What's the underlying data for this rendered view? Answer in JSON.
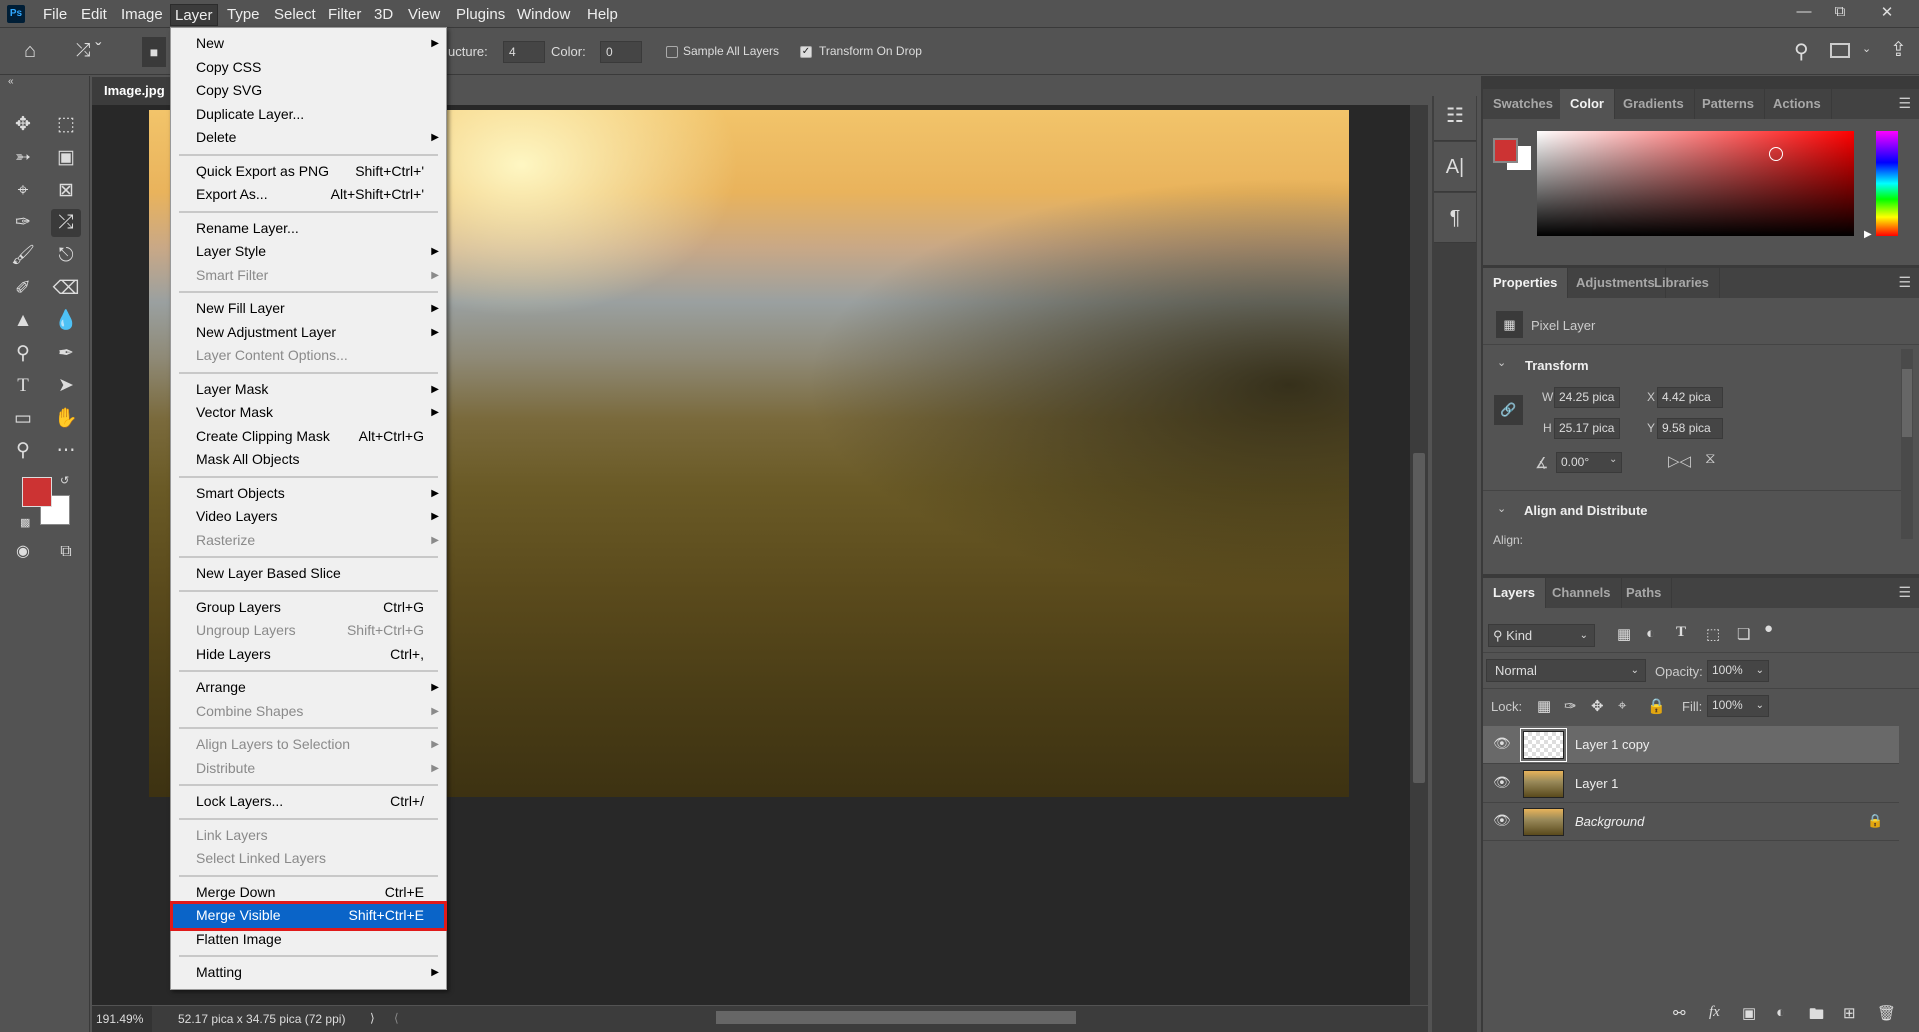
{
  "menubar": {
    "logo": "Ps",
    "items": [
      "File",
      "Edit",
      "Image",
      "Layer",
      "Type",
      "Select",
      "Filter",
      "3D",
      "View",
      "Plugins",
      "Window",
      "Help"
    ],
    "active": "Layer",
    "window_controls": [
      "minimize-icon",
      "restore-icon",
      "close-icon"
    ]
  },
  "options": {
    "structure_label": "ucture:",
    "structure_value": "4",
    "color_label": "Color:",
    "color_value": "0",
    "sample_all_layers": {
      "label": "Sample All Layers",
      "checked": false
    },
    "transform_on_drop": {
      "label": "Transform On Drop",
      "checked": true
    }
  },
  "document": {
    "tab": "Image.jpg",
    "zoom": "191.49%",
    "info": "52.17 pica x 34.75 pica (72 ppi)"
  },
  "colors": {
    "foreground": "#cc3333",
    "background": "#ffffff",
    "highlight": "#0a64c8",
    "annotation": "#e01a1a"
  },
  "layer_menu": [
    {
      "label": "New",
      "submenu": true
    },
    {
      "label": "Copy CSS"
    },
    {
      "label": "Copy SVG"
    },
    {
      "label": "Duplicate Layer..."
    },
    {
      "label": "Delete",
      "submenu": true
    },
    {
      "sep": true
    },
    {
      "label": "Quick Export as PNG",
      "shortcut": "Shift+Ctrl+'"
    },
    {
      "label": "Export As...",
      "shortcut": "Alt+Shift+Ctrl+'"
    },
    {
      "sep": true
    },
    {
      "label": "Rename Layer..."
    },
    {
      "label": "Layer Style",
      "submenu": true
    },
    {
      "label": "Smart Filter",
      "submenu": true,
      "disabled": true
    },
    {
      "sep": true
    },
    {
      "label": "New Fill Layer",
      "submenu": true
    },
    {
      "label": "New Adjustment Layer",
      "submenu": true
    },
    {
      "label": "Layer Content Options...",
      "disabled": true
    },
    {
      "sep": true
    },
    {
      "label": "Layer Mask",
      "submenu": true
    },
    {
      "label": "Vector Mask",
      "submenu": true
    },
    {
      "label": "Create Clipping Mask",
      "shortcut": "Alt+Ctrl+G"
    },
    {
      "label": "Mask All Objects"
    },
    {
      "sep": true
    },
    {
      "label": "Smart Objects",
      "submenu": true
    },
    {
      "label": "Video Layers",
      "submenu": true
    },
    {
      "label": "Rasterize",
      "submenu": true,
      "disabled": true
    },
    {
      "sep": true
    },
    {
      "label": "New Layer Based Slice"
    },
    {
      "sep": true
    },
    {
      "label": "Group Layers",
      "shortcut": "Ctrl+G"
    },
    {
      "label": "Ungroup Layers",
      "shortcut": "Shift+Ctrl+G",
      "disabled": true
    },
    {
      "label": "Hide Layers",
      "shortcut": "Ctrl+,"
    },
    {
      "sep": true
    },
    {
      "label": "Arrange",
      "submenu": true
    },
    {
      "label": "Combine Shapes",
      "submenu": true,
      "disabled": true
    },
    {
      "sep": true
    },
    {
      "label": "Align Layers to Selection",
      "submenu": true,
      "disabled": true
    },
    {
      "label": "Distribute",
      "submenu": true,
      "disabled": true
    },
    {
      "sep": true
    },
    {
      "label": "Lock Layers...",
      "shortcut": "Ctrl+/"
    },
    {
      "sep": true
    },
    {
      "label": "Link Layers",
      "disabled": true
    },
    {
      "label": "Select Linked Layers",
      "disabled": true
    },
    {
      "sep": true
    },
    {
      "label": "Merge Down",
      "shortcut": "Ctrl+E"
    },
    {
      "label": "Merge Visible",
      "shortcut": "Shift+Ctrl+E",
      "highlighted": true
    },
    {
      "label": "Flatten Image"
    },
    {
      "sep": true
    },
    {
      "label": "Matting",
      "submenu": true
    }
  ],
  "color_panel": {
    "tabs": [
      "Swatches",
      "Color",
      "Gradients",
      "Patterns",
      "Actions"
    ],
    "active": "Color"
  },
  "properties": {
    "tabs": [
      "Properties",
      "Adjustments",
      "Libraries"
    ],
    "active": "Properties",
    "type": "Pixel Layer",
    "transform_title": "Transform",
    "w_label": "W",
    "w": "24.25 pica",
    "h_label": "H",
    "h": "25.17 pica",
    "x_label": "X",
    "x": "4.42 pica",
    "y_label": "Y",
    "y": "9.58 pica",
    "angle": "0.00°",
    "align_title": "Align and Distribute",
    "align_label": "Align:"
  },
  "layers_panel": {
    "tabs": [
      "Layers",
      "Channels",
      "Paths"
    ],
    "active": "Layers",
    "filter": "Kind",
    "blend_mode": "Normal",
    "opacity_label": "Opacity:",
    "opacity": "100%",
    "lock_label": "Lock:",
    "fill_label": "Fill:",
    "fill": "100%",
    "layers": [
      {
        "name": "Layer 1 copy",
        "selected": true,
        "visible": true
      },
      {
        "name": "Layer 1",
        "visible": true
      },
      {
        "name": "Background",
        "visible": true,
        "locked": true,
        "italic": true
      }
    ]
  }
}
